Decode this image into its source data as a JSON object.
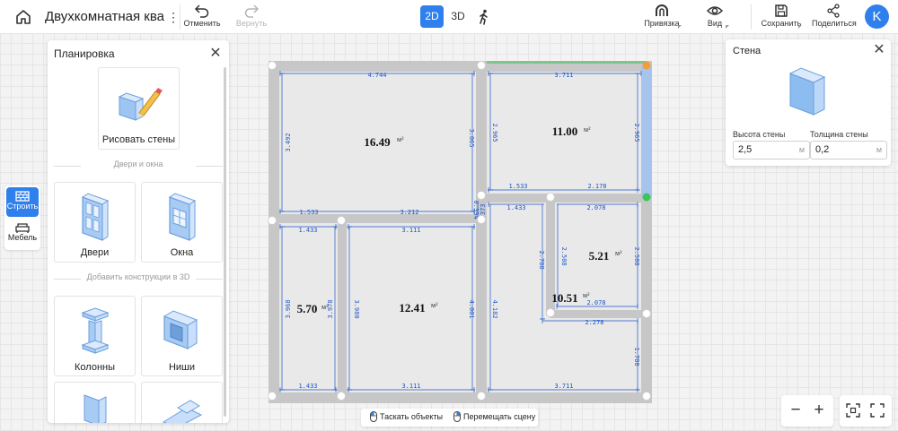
{
  "header": {
    "project_title": "Двухкомнатная квар",
    "undo_label": "Отменить",
    "redo_label": "Вернуть",
    "mode_2d": "2D",
    "mode_3d": "3D",
    "snap_label": "Привязка",
    "view_label": "Вид",
    "save_label": "Сохранить",
    "share_label": "Поделиться",
    "avatar_letter": "K"
  },
  "rail": {
    "build_label": "Строить",
    "furniture_label": "Мебель"
  },
  "panel": {
    "title": "Планировка",
    "draw_walls_label": "Рисовать стены",
    "section_doors": "Двери и окна",
    "doors_label": "Двери",
    "windows_label": "Окна",
    "section_3d": "Добавить конструкции в 3D",
    "columns_label": "Колонны",
    "niches_label": "Ниши"
  },
  "wall_panel": {
    "title": "Стена",
    "height_label": "Высота стены",
    "height_value": "2,5",
    "thickness_label": "Толщина стены",
    "thickness_value": "0,2",
    "unit": "м"
  },
  "hints": {
    "drag_objects": "Таскать объекты",
    "move_scene": "Перемещать сцену"
  },
  "zoom": {
    "minus": "−",
    "plus": "+"
  },
  "plan": {
    "area_unit": "м²",
    "rooms": [
      {
        "name": "room-living",
        "area": "16.49"
      },
      {
        "name": "room-bedroom",
        "area": "11.00"
      },
      {
        "name": "room-bath",
        "area": "5.21"
      },
      {
        "name": "room-hall",
        "area": "10.51"
      },
      {
        "name": "room-small",
        "area": "5.70"
      },
      {
        "name": "room-kitchen",
        "area": "12.41"
      }
    ],
    "dimensions": {
      "top_left": "4.744",
      "top_right": "3.711",
      "left_upper": "3.492",
      "living_right": "3.065",
      "bedroom_left": "2.965",
      "bedroom_right": "2.965",
      "bedroom_bottom_l": "1.533",
      "bedroom_bottom_r": "2.178",
      "living_bottom_l": "1.533",
      "living_bottom_r": "3.212",
      "mid_v1": "0.394",
      "mid_v2": "0.373",
      "bath_top_l": "1.433",
      "bath_top_r": "2.078",
      "bath_left": "2.508",
      "bath_right": "2.508",
      "hall_v": "2.788",
      "bath_bottom": "2.078",
      "hall_bottom": "2.278",
      "small_top": "1.433",
      "kitchen_top": "3.111",
      "left_lower": "3.968",
      "small_right": "3.978",
      "kitchen_left": "3.980",
      "kitchen_right": "4.001",
      "hall_left": "4.182",
      "right_lower": "1.788",
      "bottom_small": "1.433",
      "bottom_kitchen": "3.111",
      "bottom_right": "3.711"
    }
  },
  "colors": {
    "accent": "#2f80ed",
    "wall": "#c7c7c7",
    "floor": "#e9e9e9",
    "dimension": "#1e56c8",
    "node_orange": "#f39c3a",
    "node_green": "#3cc55a"
  }
}
